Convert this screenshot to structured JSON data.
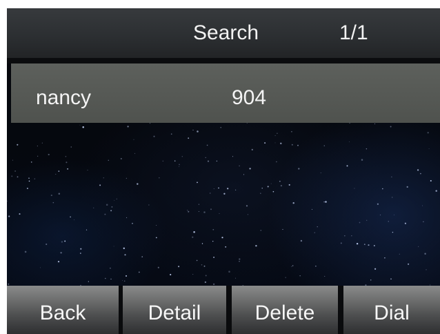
{
  "header": {
    "title": "Search",
    "page_indicator": "1/1"
  },
  "results": [
    {
      "name": "nancy",
      "number": "904",
      "selected": true
    }
  ],
  "softkeys": {
    "back": "Back",
    "detail": "Detail",
    "delete": "Delete",
    "dial": "Dial"
  },
  "colors": {
    "header_bg": "#2c2f32",
    "selected_row_bg": "#555854",
    "softkey_bg": "#5e5f60",
    "text": "#f4f4f4",
    "wallpaper": "#060a14"
  },
  "wallpaper": "starfield"
}
